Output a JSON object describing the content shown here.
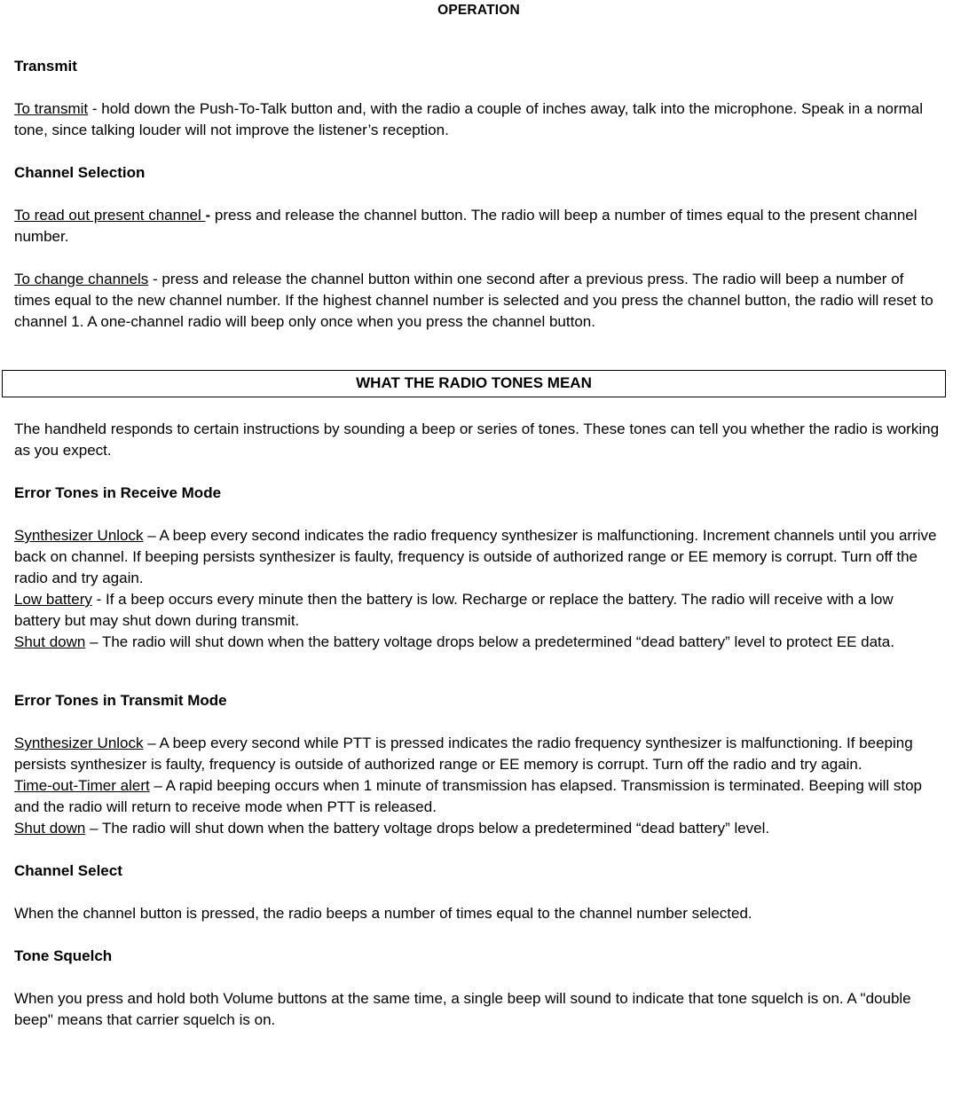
{
  "document": {
    "header_title": "OPERATION",
    "banner_title": "WHAT THE RADIO TONES MEAN",
    "sections": {
      "transmit": {
        "heading": "Transmit",
        "lead_in": "To transmit",
        "body": " - hold down the Push-To-Talk button and, with the radio a couple of inches away, talk into the microphone.  Speak in a normal tone, since talking louder will not improve the listener’s reception."
      },
      "channel_selection": {
        "heading": "Channel Selection",
        "read_out": {
          "lead_in": "To read out present channel ",
          "dash": "-",
          "body": " press and release the channel button.  The radio will beep a number of times equal to the present channel number."
        },
        "change": {
          "lead_in": "To change channels",
          "body": " - press and release the channel button within one second after a previous press.  The radio will beep a number of times equal to the new channel number.  If the highest channel number is selected and you press the channel button, the radio will reset to channel 1.  A one-channel radio will beep only once when you press the channel button."
        }
      },
      "tones_intro": {
        "body": "The handheld responds to certain instructions by sounding a beep or series of tones.  These tones can tell you whether the radio is working as you expect."
      },
      "receive_mode": {
        "heading": "Error Tones in Receive Mode",
        "entries": [
          {
            "lead_in": "Synthesizer Unlock",
            "body": " – A beep every second indicates the radio frequency synthesizer is malfunctioning. Increment channels until you arrive back on channel. If beeping persists synthesizer is faulty, frequency is outside of authorized range or EE memory is corrupt. Turn off the radio and try again."
          },
          {
            "lead_in": "Low battery",
            "body": " - If a beep occurs every minute then the battery is low.  Recharge or replace the battery. The radio will receive with a low battery but may shut down during transmit."
          },
          {
            "lead_in": "Shut down",
            "body": " – The radio will shut down when the battery voltage drops below a predetermined “dead battery” level to protect EE data."
          }
        ]
      },
      "transmit_mode": {
        "heading": "Error Tones in Transmit Mode",
        "entries": [
          {
            "lead_in": "Synthesizer Unlock",
            "body": " – A beep every second while PTT is pressed indicates the radio frequency synthesizer is malfunctioning. If beeping persists synthesizer is faulty, frequency is outside of authorized range or EE memory is corrupt. Turn off the radio and try again."
          },
          {
            "lead_in": "Time-out-Timer alert",
            "body": " – A rapid beeping occurs when 1 minute of transmission has elapsed. Transmission is terminated. Beeping will stop and the radio will return to receive mode when PTT is released."
          },
          {
            "lead_in": "Shut down",
            "body": " – The radio will shut down when the battery voltage drops below a predetermined “dead battery” level."
          }
        ]
      },
      "channel_select": {
        "heading": "Channel Select",
        "body": "When the channel button is pressed, the radio beeps a number of times equal to the channel number selected."
      },
      "tone_squelch": {
        "heading": "Tone Squelch",
        "body": "When you press and hold both Volume buttons at the same time, a single beep will sound to indicate that tone squelch is on.  A \"double beep\" means that carrier squelch is on."
      }
    }
  }
}
